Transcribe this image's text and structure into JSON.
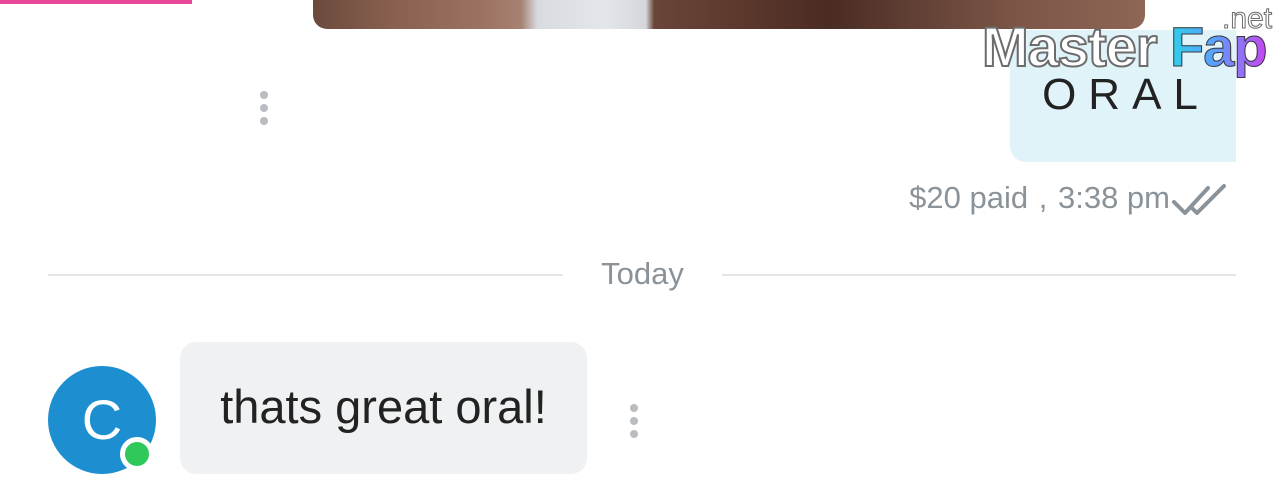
{
  "sent_message": {
    "text": "ORAL",
    "price": "$20 paid",
    "separator": ",",
    "time": "3:38 pm",
    "status_icon": "double-check-icon"
  },
  "day_divider": {
    "label": "Today"
  },
  "received_message": {
    "avatar_initial": "C",
    "text": "thats great oral!",
    "online_color": "#2ec85b"
  },
  "watermark": {
    "part1": "Master",
    "part2": "Fap",
    "part3": ".net"
  },
  "colors": {
    "accent_pink": "#e8489a",
    "sent_bubble": "#dff3f9",
    "received_bubble": "#eff1f2",
    "avatar": "#1d8fd0",
    "meta_text": "#8a9399"
  },
  "icons": [
    "more-vertical-icon",
    "double-check-icon"
  ]
}
